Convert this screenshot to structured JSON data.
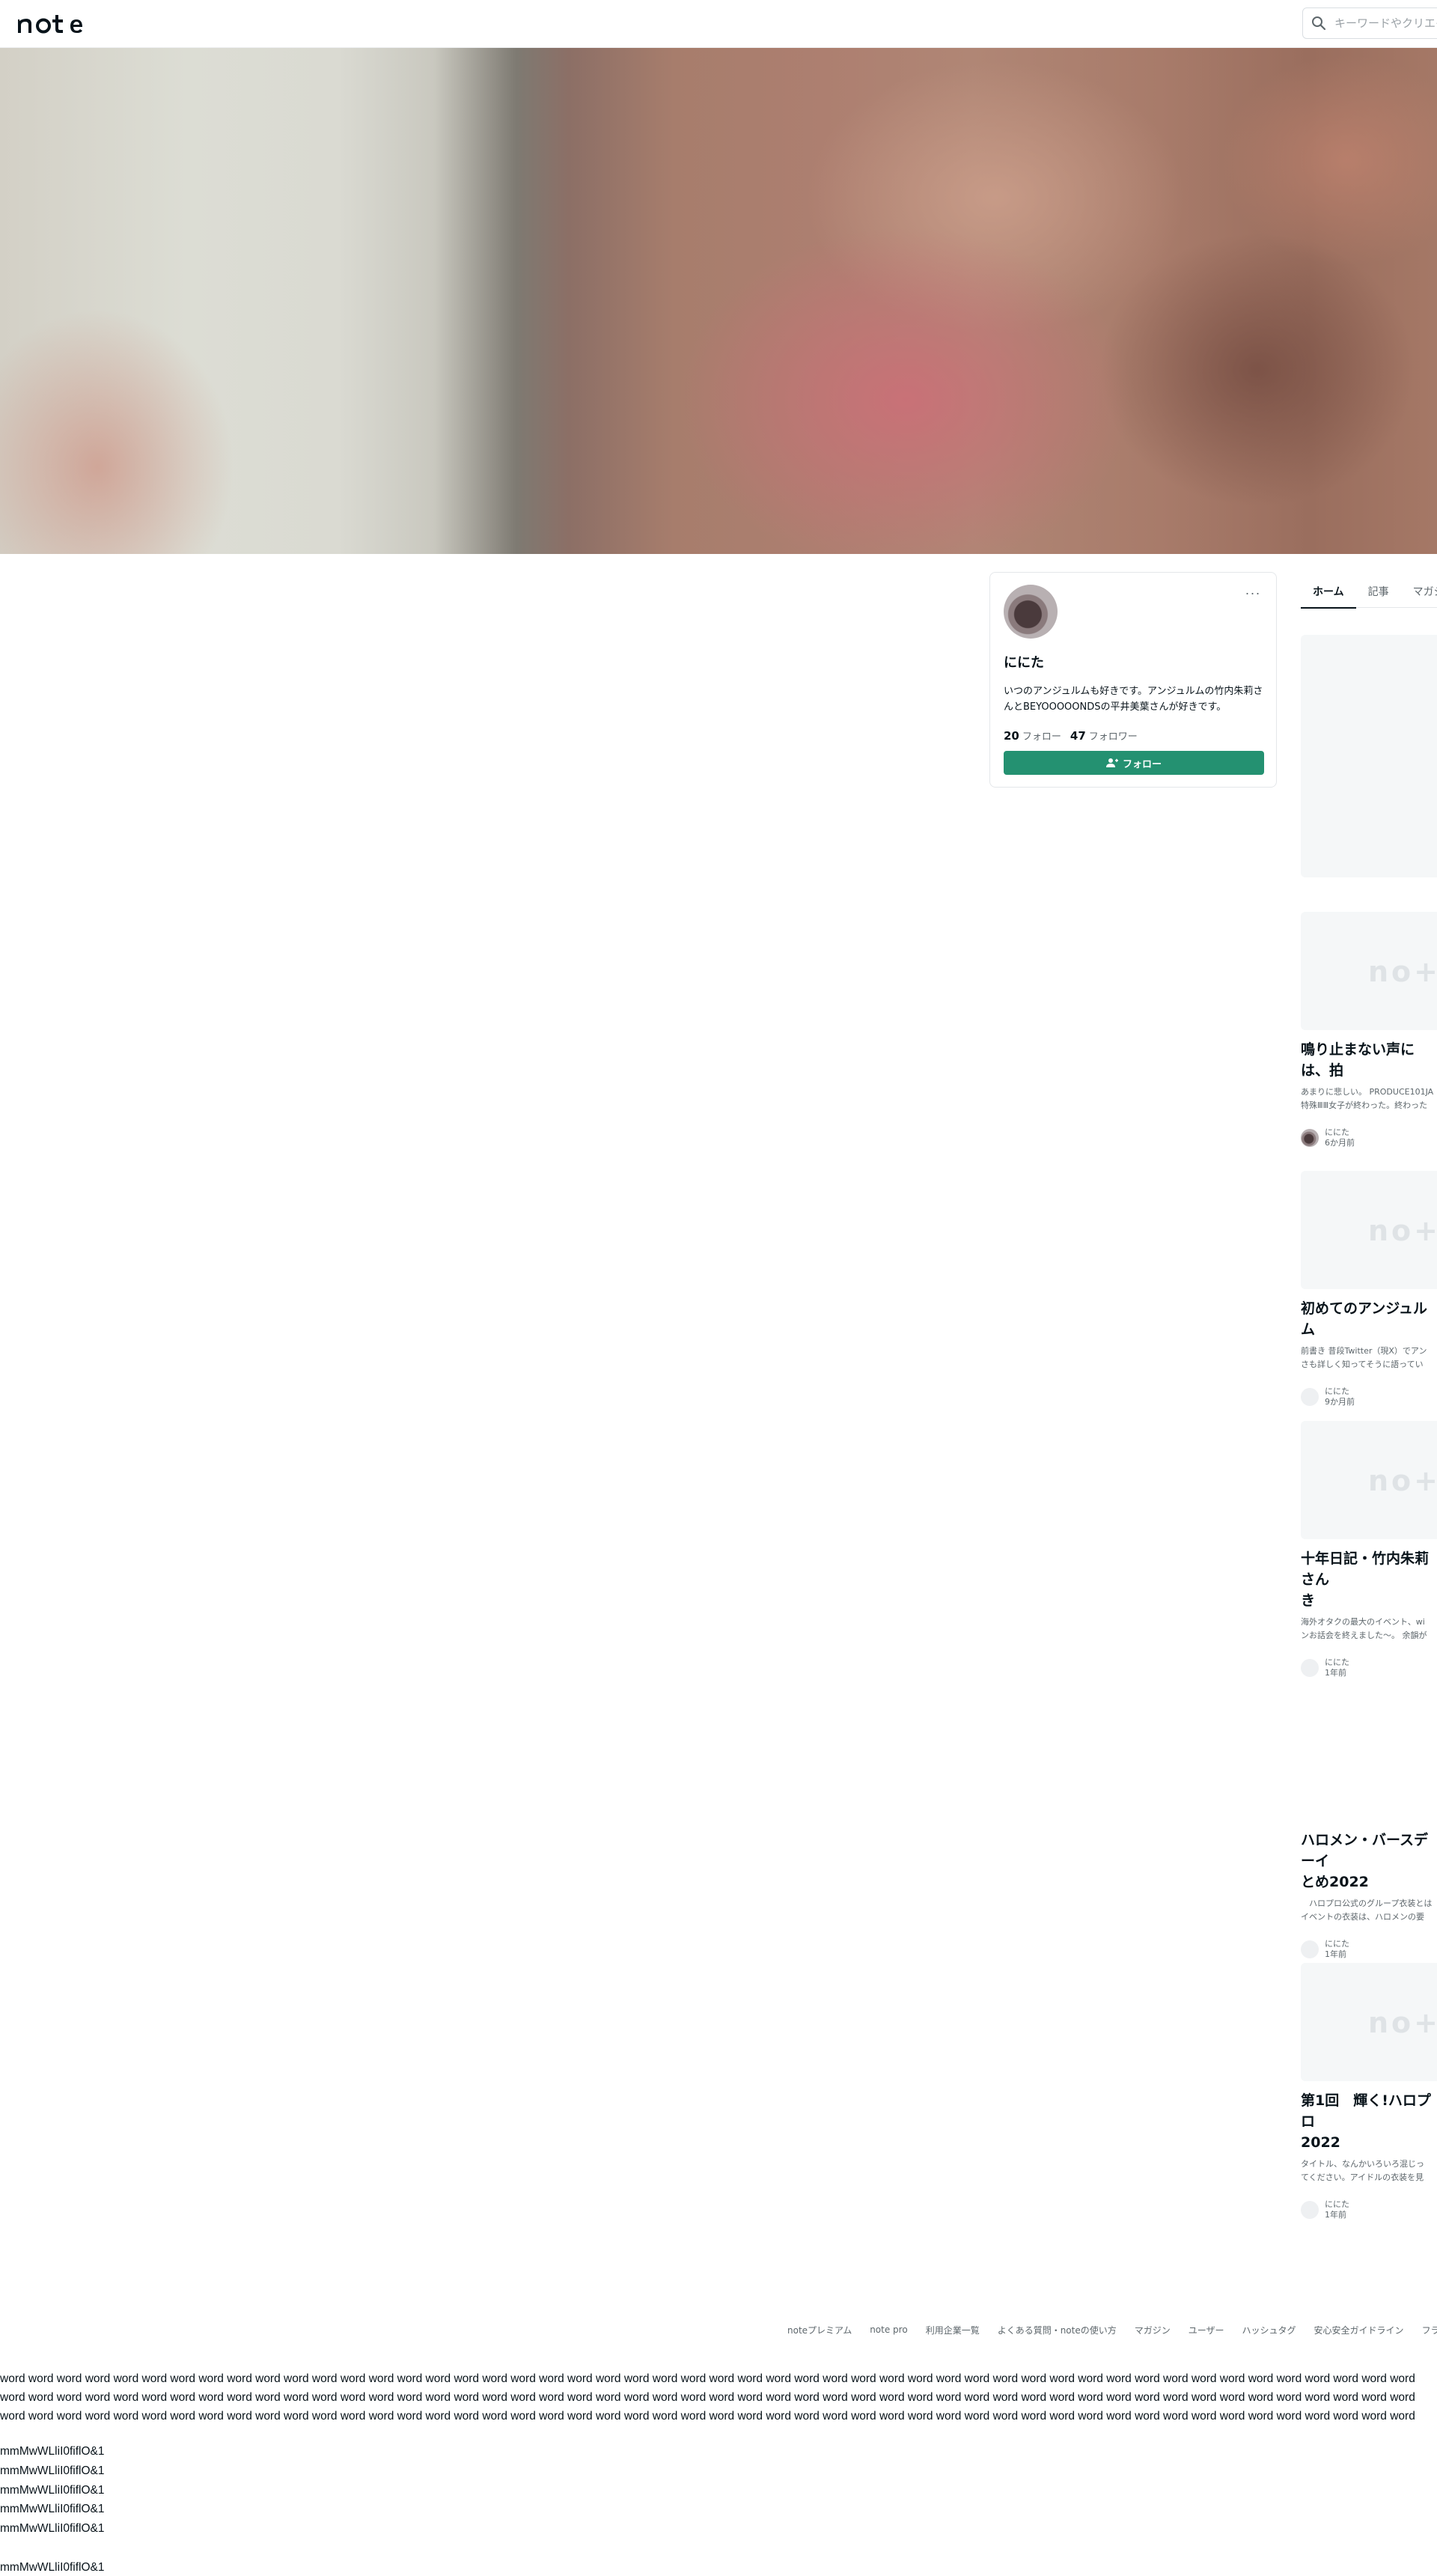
{
  "header": {
    "logo_text": "note",
    "search_placeholder": "キーワードやクリエイターで検索"
  },
  "profile": {
    "name": "ににた",
    "bio": "いつのアンジュルムも好きです。アンジュルムの竹内朱莉さんとBEYOOOOONDSの平井美葉さんが好きです。",
    "following_count": "20",
    "following_label": "フォロー",
    "followers_count": "47",
    "followers_label": "フォロワー",
    "follow_button": "フォロー",
    "more_label": "···"
  },
  "tabs": [
    {
      "label": "ホーム",
      "active": true
    },
    {
      "label": "記事",
      "active": false
    },
    {
      "label": "マガジン",
      "active": false
    }
  ],
  "articles": [
    {
      "title": "鳴り止まない声には、拍",
      "desc": "あまりに悲しい。 PRODUCE101JA\n特殊ⅢⅢ女子が終わった。終わった",
      "author": "ににた",
      "time": "6か月前",
      "has_thumb": true,
      "author_photo": true
    },
    {
      "title": "初めてのアンジュルム",
      "desc": "前書き 昔段Twitter（現X）でアン\nさも詳しく知ってそうに語ってい",
      "author": "ににた",
      "time": "9か月前",
      "has_thumb": true,
      "author_photo": false
    },
    {
      "title": "十年日記・竹内朱莉さん\nき",
      "desc": "海外オタクの最大のイベント、wi\nンお話会を終えました〜。 余韻が",
      "author": "ににた",
      "time": "1年前",
      "has_thumb": true,
      "author_photo": false
    },
    {
      "title": "ハロメン・バースデーイ\nとめ2022",
      "desc": "　ハロプロ公式のグループ衣装とは\nイベントの衣装は、ハロメンの要",
      "author": "ににた",
      "time": "1年前",
      "has_thumb": false,
      "author_photo": false
    },
    {
      "title": "第1回　輝く!ハロプロ\n2022",
      "desc": "タイトル、なんかいろいろ混じっ\nてください。アイドルの衣装を見",
      "author": "ににた",
      "time": "1年前",
      "has_thumb": true,
      "author_photo": false
    }
  ],
  "footer": {
    "links": [
      "noteプレミアム",
      "note pro",
      "利用企業一覧",
      "よくある質問・noteの使い方",
      "マガジン",
      "ユーザー",
      "ハッシュタグ",
      "安心安全ガイドライン",
      "フラ"
    ]
  },
  "overflow_text": "word word word word word word word word word word word word word word word word word word word word word word word word word word word word word word word word word word word word word word word word word word word word word word word word word word word word word word word word word word word word word word word word word word word word word word word word word word word word word word word word word word word word word word word word word word word word word word word word word word word word word word word word word word word word word word word word word word word word word word word word word word word word word word word word word word word word word word word word word word word word word word word word word word word word word word word word word word word word word word word",
  "probe_lines": [
    "mmMwWLliI0fiflO&1",
    "mmMwWLliI0fiflO&1",
    "mmMwWLliI0fiflO&1",
    "mmMwWLliI0fiflO&1",
    "mmMwWLliI0fiflO&1",
    "",
    "mmMwWLliI0fiflO&1"
  ]
}
